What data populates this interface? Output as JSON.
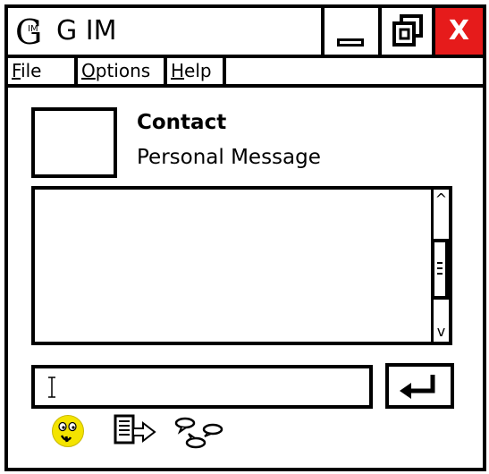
{
  "window": {
    "logo_text": "G",
    "logo_sub": "IM",
    "title": "G IM",
    "close_label": "X"
  },
  "menu": {
    "file": {
      "accel": "F",
      "rest": "ile"
    },
    "options": {
      "accel": "O",
      "rest": "ptions"
    },
    "help": {
      "accel": "H",
      "rest": "elp"
    }
  },
  "contact": {
    "name": "Contact",
    "personal_message": "Personal Message"
  },
  "chat_scroll": {
    "up": "^",
    "down": "v"
  },
  "message_input": {
    "value": ""
  },
  "icons": {
    "emoticon": "emoticon-icon",
    "send_file": "send-file-icon",
    "conversation": "chat-bubbles-icon",
    "send": "enter-arrow-icon",
    "minimize": "minimize-icon",
    "maximize": "restore-icon",
    "close": "close-icon"
  },
  "colors": {
    "close_button": "#e61b1b",
    "emoticon": "#f4e400"
  }
}
